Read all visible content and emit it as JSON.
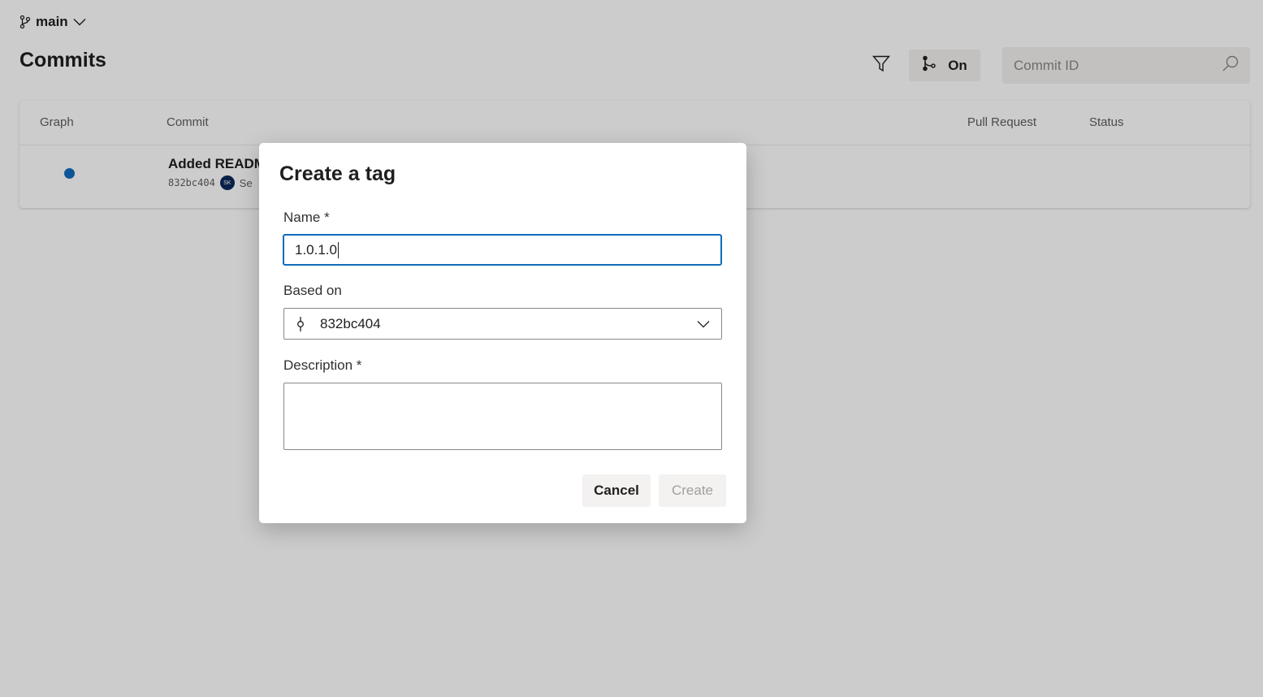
{
  "branch": {
    "name": "main",
    "icon": "git-branch-icon"
  },
  "page": {
    "title": "Commits"
  },
  "toolbar": {
    "filter_icon": "filter-icon",
    "graph_toggle_label": "On",
    "graph_toggle_icon": "graph-icon",
    "search_placeholder": "Commit ID",
    "search_icon": "search-icon"
  },
  "table": {
    "columns": [
      "Graph",
      "Commit",
      "Pull Request",
      "Status"
    ],
    "rows": [
      {
        "message": "Added READM",
        "commit_id": "832bc404",
        "author_initials": "SK",
        "author_partial": "Se"
      }
    ]
  },
  "dialog": {
    "title": "Create a tag",
    "name_label": "Name *",
    "name_value": "1.0.1.0",
    "based_on_label": "Based on",
    "based_on_value": "832bc404",
    "description_label": "Description *",
    "description_value": "",
    "cancel_label": "Cancel",
    "create_label": "Create"
  },
  "colors": {
    "accent": "#0f6cbd",
    "overlay": "rgba(0,0,0,0.2)",
    "disabled_text": "#a19f9d"
  }
}
